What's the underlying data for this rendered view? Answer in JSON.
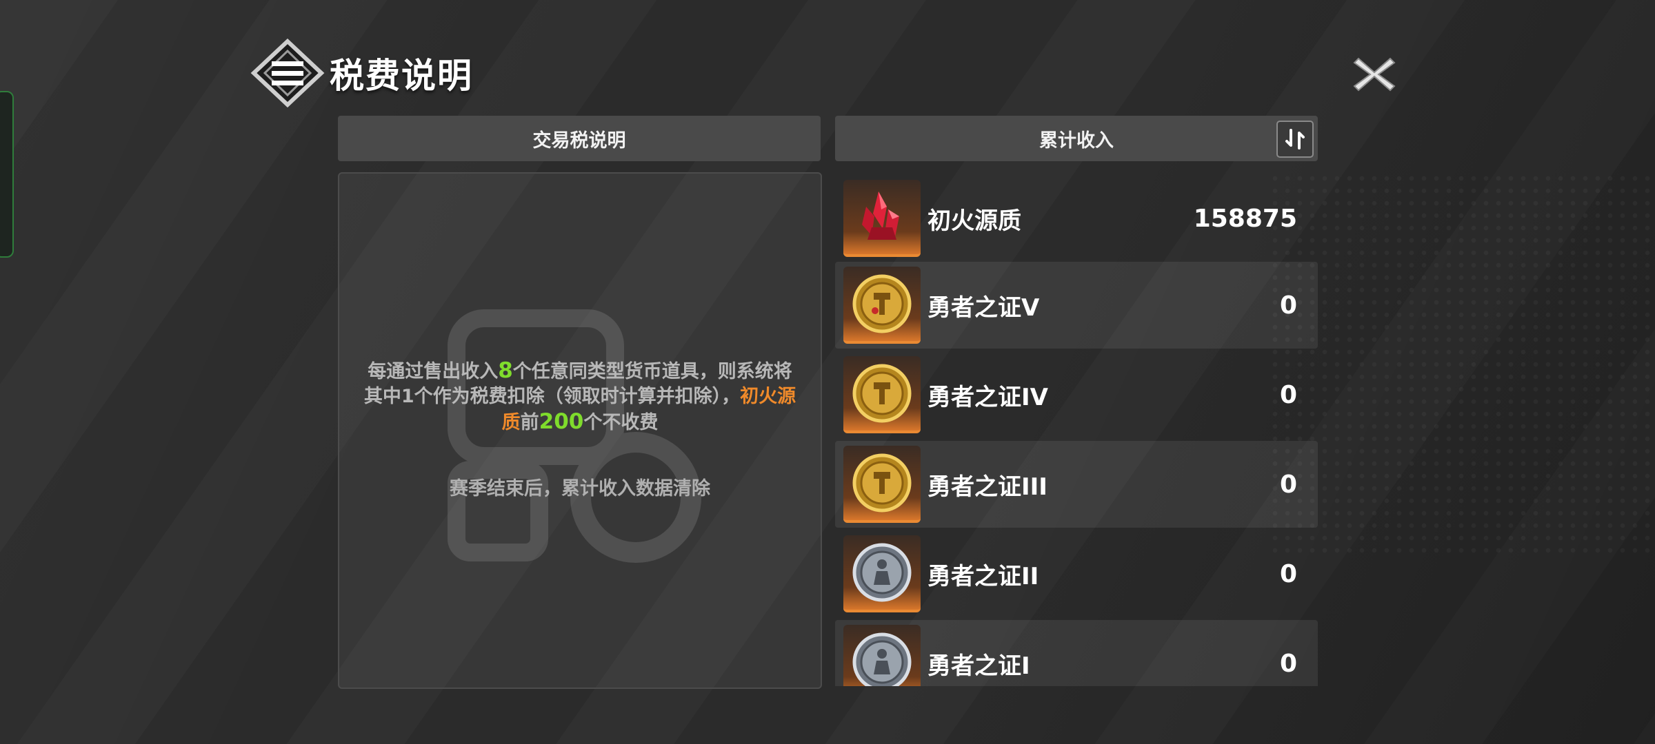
{
  "header": {
    "title": "税费说明"
  },
  "left_panel": {
    "header": "交易税说明",
    "desc": {
      "part1": "每通过售出收入",
      "num1": "8",
      "part2": "个任意同类型货币道具，则系统将其中1个作为税费扣除（领取时计算并扣除），",
      "highlight": "初火源质",
      "part3": "前",
      "num2": "200",
      "part4": "个不收费"
    },
    "note": "赛季结束后，累计收入数据清除"
  },
  "right_panel": {
    "header": "累计收入",
    "items": [
      {
        "name": "初火源质",
        "value": "158875",
        "icon": "red-crystal-icon"
      },
      {
        "name": "勇者之证V",
        "value": "0",
        "icon": "gold-medal-icon"
      },
      {
        "name": "勇者之证IV",
        "value": "0",
        "icon": "gold-medal-icon"
      },
      {
        "name": "勇者之证III",
        "value": "0",
        "icon": "gold-medal-icon"
      },
      {
        "name": "勇者之证II",
        "value": "0",
        "icon": "silver-medal-icon"
      },
      {
        "name": "勇者之证I",
        "value": "0",
        "icon": "silver-medal-icon"
      }
    ]
  },
  "colors": {
    "accent_green": "#7fdc2c",
    "accent_orange": "#f08a2a",
    "tile_orange": "#ea8a33"
  }
}
